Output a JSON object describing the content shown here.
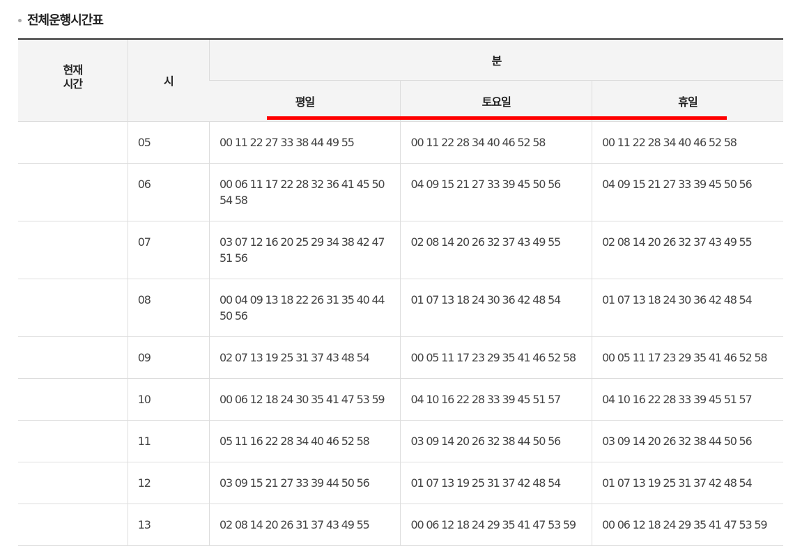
{
  "section": {
    "title": "전체운행시간표"
  },
  "header": {
    "current_time_line1": "현재",
    "current_time_line2": "시간",
    "hour": "시",
    "minute": "분",
    "day_types": [
      "평일",
      "토요일",
      "휴일"
    ]
  },
  "rows": [
    {
      "now": "",
      "hour": "05",
      "weekday": "00 11 22 27 33 38 44 49 55",
      "saturday": "00 11 22 28 34 40 46 52 58",
      "holiday": "00 11 22 28 34 40 46 52 58"
    },
    {
      "now": "",
      "hour": "06",
      "weekday": "00 06 11 17 22 28 32 36 41 45 50 54 58",
      "saturday": "04 09 15 21 27 33 39 45 50 56",
      "holiday": "04 09 15 21 27 33 39 45 50 56"
    },
    {
      "now": "",
      "hour": "07",
      "weekday": "03 07 12 16 20 25 29 34 38 42 47 51 56",
      "saturday": "02 08 14 20 26 32 37 43 49 55",
      "holiday": "02 08 14 20 26 32 37 43 49 55"
    },
    {
      "now": "",
      "hour": "08",
      "weekday": "00 04 09 13 18 22 26 31 35 40 44 50 56",
      "saturday": "01 07 13 18 24 30 36 42 48 54",
      "holiday": "01 07 13 18 24 30 36 42 48 54"
    },
    {
      "now": "",
      "hour": "09",
      "weekday": "02 07 13 19 25 31 37 43 48 54",
      "saturday": "00 05 11 17 23 29 35 41 46 52 58",
      "holiday": "00 05 11 17 23 29 35 41 46 52 58"
    },
    {
      "now": "",
      "hour": "10",
      "weekday": "00 06 12 18 24 30 35 41 47 53 59",
      "saturday": "04 10 16 22 28 33 39 45 51 57",
      "holiday": "04 10 16 22 28 33 39 45 51 57"
    },
    {
      "now": "",
      "hour": "11",
      "weekday": "05 11 16 22 28 34 40 46 52 58",
      "saturday": "03 09 14 20 26 32 38 44 50 56",
      "holiday": "03 09 14 20 26 32 38 44 50 56"
    },
    {
      "now": "",
      "hour": "12",
      "weekday": "03 09 15 21 27 33 39 44 50 56",
      "saturday": "01 07 13 19 25 31 37 42 48 54",
      "holiday": "01 07 13 19 25 31 37 42 48 54"
    },
    {
      "now": "",
      "hour": "13",
      "weekday": "02 08 14 20 26 31 37 43 49 55",
      "saturday": "00 06 12 18 24 29 35 41 47 53 59",
      "holiday": "00 06 12 18 24 29 35 41 47 53 59"
    }
  ],
  "colors": {
    "highlight": "#ff0000",
    "header_bg": "#f4f4f4",
    "border": "#dddddd"
  }
}
